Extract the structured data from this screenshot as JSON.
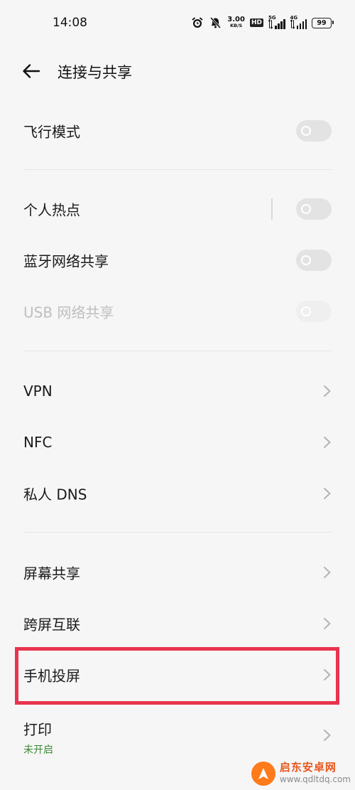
{
  "status_bar": {
    "time": "14:08",
    "net_speed_value": "3.00",
    "net_speed_unit": "KB/S",
    "hd_badge": "HD",
    "sim1_network": "5G",
    "sim2_network": "4G",
    "battery": "99"
  },
  "header": {
    "title": "连接与共享"
  },
  "rows": {
    "airplane": {
      "label": "飞行模式"
    },
    "hotspot": {
      "label": "个人热点"
    },
    "bluetooth_share": {
      "label": "蓝牙网络共享"
    },
    "usb_share": {
      "label": "USB 网络共享"
    },
    "vpn": {
      "label": "VPN"
    },
    "nfc": {
      "label": "NFC"
    },
    "private_dns": {
      "label": "私人 DNS"
    },
    "screen_share": {
      "label": "屏幕共享"
    },
    "cross_screen": {
      "label": "跨屏互联"
    },
    "phone_cast": {
      "label": "手机投屏"
    },
    "print": {
      "label": "打印",
      "sub": "未开启"
    }
  },
  "watermark": {
    "name": "启东安卓网",
    "url": "www.qdltdq.com"
  },
  "colors": {
    "background": "#f6f6f6",
    "highlight": "#e8344e",
    "subtext": "#3d8a37"
  }
}
